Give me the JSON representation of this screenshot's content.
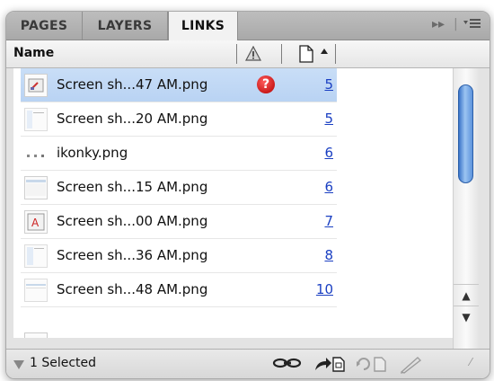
{
  "tabs": [
    {
      "label": "PAGES",
      "active": false
    },
    {
      "label": "LAYERS",
      "active": false
    },
    {
      "label": "LINKS",
      "active": true
    }
  ],
  "toolbar_icons": [
    "fast-forward-icon",
    "panel-menu-icon"
  ],
  "columns": {
    "name_label": "Name",
    "warning_icon": "warning-triangle-icon",
    "page_icon": "page-icon",
    "sort": "ascending"
  },
  "links": [
    {
      "name": "Screen sh...47 AM.png",
      "page": "5",
      "status": "missing",
      "selected": true
    },
    {
      "name": "Screen sh...20 AM.png",
      "page": "5",
      "status": "ok",
      "selected": false
    },
    {
      "name": "ikonky.png",
      "page": "6",
      "status": "ok",
      "selected": false
    },
    {
      "name": "Screen sh...15 AM.png",
      "page": "6",
      "status": "ok",
      "selected": false
    },
    {
      "name": "Screen sh...00 AM.png",
      "page": "7",
      "status": "ok",
      "selected": false
    },
    {
      "name": "Screen sh...36 AM.png",
      "page": "8",
      "status": "ok",
      "selected": false
    },
    {
      "name": "Screen sh...48 AM.png",
      "page": "10",
      "status": "ok",
      "selected": false
    }
  ],
  "footer": {
    "status": "1 Selected",
    "icons": [
      "relink-icon",
      "go-to-link-icon",
      "update-link-icon",
      "edit-original-icon"
    ]
  },
  "colors": {
    "selection": "#bcd5f4",
    "missing": "#c00000",
    "page_link": "#1a3fc2",
    "scroll_thumb": "#4f8ad6"
  }
}
